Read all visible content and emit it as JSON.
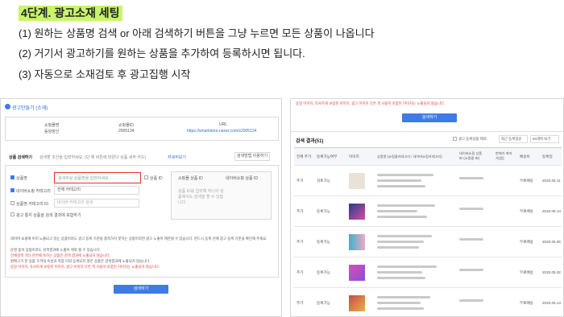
{
  "heading": "4단계. 광고소재 세팅",
  "steps": [
    "(1) 원하는 상품명 검색 or 아래 검색하기 버튼을 그냥 누르면 모든 상품이 나옵니다",
    "(2) 거기서 광고하기를 원하는 상품을 추가하여 등록하시면 됩니다.",
    "(3) 자동으로 소재검토 후 광고집행 시작"
  ],
  "left": {
    "header": "광고만들기 (소재)",
    "store": {
      "name_label": "쇼핑몰명",
      "name_value": "동양장인",
      "id_label": "쇼핑몰ID",
      "id_value": "2005134",
      "url_label": "URL",
      "url_value": "https://smartstore.naver.com/s2005134"
    },
    "search_title": "상품 검색하기",
    "search_hint": "검색할 조건을 입력하세요. (단 해 버튼에 따른다 상품 세부 카드)",
    "search_link": "자세히보기",
    "search_help": "검색방법 이용하기",
    "cond_name": "상품명",
    "cond_name_placeholder": "검색하실 상품명을 입력하세요",
    "cond_id": "상품 ID",
    "cond_category": "네이버쇼핑 카테고리",
    "cond_category_value": "전체 카테고리",
    "cond_brand": "상품명 카테고리 ID",
    "cond_brand_placeholder": "네이버 카테고리 검색",
    "cond_include": "광고 통지 상품을 검색 결과에 포함하기",
    "opt1": "쇼핑몰 상품 ID",
    "opt2": "네이버쇼핑 상품 ID",
    "side_text": "상품 ID를 입력해 하나의 상품에서도 검색을 할 수 있습니다",
    "notes": [
      "네이버 쇼핑에 이미 노출되고 있는 상품이라도 광고 등록 기준을 충족하지 못하는 상품이라면 광고 노출이 제한될 수 있습니다. 반드시 등록 전에 광고 등록 기준을 확인해 주세요.",
      "운영 중이 상품이라도 검색결과에 노출이 제외 될 수 있습니다.",
      "전체검색 기타 관련에 속하는 상품은 검색 결과에 노출되지 않습니다.",
      "판매고가 한 상품 가격대 속성과 작업 이외 등록되지 않은 상품은 검색결과에 노출되지 않습니다.",
      "동일 이미지, 유사하게 보정된 이미지, 광고 이미지 다른 색 사용이 포함된 이미지는 노출되지 않습니다."
    ],
    "search_button": "검색하기"
  },
  "right": {
    "top_note": "동일 이미지, 유사하게 보정된 이미지, 광고 이미지 다른 색 사용이 포함된 이미지는 노출되지 않습니다.",
    "search_button": "검색하기",
    "results_title": "검색 결과(51)",
    "filter_label": "광고 등록상품 제외",
    "sort1": "최근 등록일순",
    "sort2": "50개씩 보기",
    "columns": [
      "전체 추가",
      "등록가능여부",
      "이미지",
      "상품명 (쇼핑몰카테고리 / 네이버쇼핑카테고리)",
      "네이버쇼핑 상품 ID (쇼핑몰 ID)",
      "판매가 최저가(원)",
      "배송비",
      "등록일"
    ],
    "rows": [
      {
        "action": "추가",
        "status": "검토가능",
        "price": "",
        "ship": "무료배송",
        "date": "2020.05.11"
      },
      {
        "action": "추가",
        "status": "등록가능",
        "price": "",
        "ship": "무료배송",
        "date": "2020.05.14"
      },
      {
        "action": "추가",
        "status": "등록가능",
        "price": "",
        "ship": "무료배송",
        "date": "2020.05.06"
      },
      {
        "action": "추가",
        "status": "등록가능",
        "price": "",
        "ship": "무료배송",
        "date": "2020.05.02"
      },
      {
        "action": "추가",
        "status": "등록가능",
        "price": "",
        "ship": "무료배송",
        "date": "2020.05.14"
      }
    ]
  },
  "colors": {
    "highlight": "#c9f46a",
    "accent": "#3e7be8",
    "red": "#e03b3b"
  }
}
